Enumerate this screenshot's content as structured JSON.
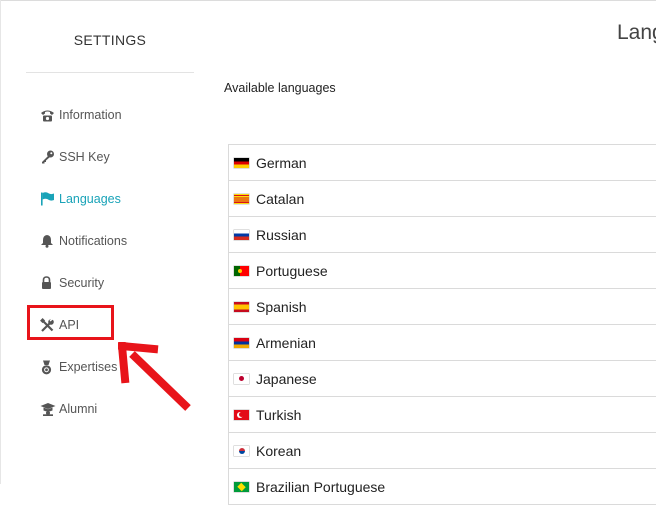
{
  "sidebar": {
    "title": "SETTINGS",
    "items": [
      {
        "label": "Information",
        "icon": "phone-icon"
      },
      {
        "label": "SSH Key",
        "icon": "key-icon"
      },
      {
        "label": "Languages",
        "icon": "flag-icon",
        "active": true
      },
      {
        "label": "Notifications",
        "icon": "bell-icon"
      },
      {
        "label": "Security",
        "icon": "lock-icon"
      },
      {
        "label": "API",
        "icon": "tools-icon"
      },
      {
        "label": "Expertises",
        "icon": "medal-icon"
      },
      {
        "label": "Alumni",
        "icon": "graduation-cap-icon"
      }
    ],
    "active_color": "#19a3b8"
  },
  "main": {
    "title": "Lang",
    "section_label": "Available languages",
    "languages": [
      {
        "name": "German",
        "flag": "de"
      },
      {
        "name": "Catalan",
        "flag": "ca"
      },
      {
        "name": "Russian",
        "flag": "ru"
      },
      {
        "name": "Portuguese",
        "flag": "pt"
      },
      {
        "name": "Spanish",
        "flag": "es"
      },
      {
        "name": "Armenian",
        "flag": "am"
      },
      {
        "name": "Japanese",
        "flag": "jp"
      },
      {
        "name": "Turkish",
        "flag": "tr"
      },
      {
        "name": "Korean",
        "flag": "kr"
      },
      {
        "name": "Brazilian Portuguese",
        "flag": "br"
      }
    ]
  },
  "annotation": {
    "highlight_color": "#e8141a",
    "highlighted_item": "API"
  }
}
